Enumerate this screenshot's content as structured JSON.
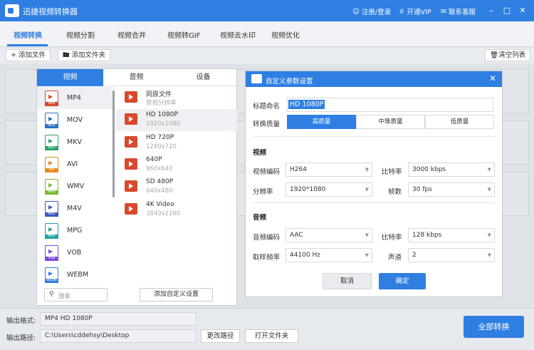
{
  "app": {
    "title": "迅捷视频转换器"
  },
  "header": {
    "login": "注册/登录",
    "vip": "开通VIP",
    "support": "联系客服"
  },
  "tabs": [
    "视频转换",
    "视频分割",
    "视频合并",
    "视频转GIF",
    "视频去水印",
    "视频优化"
  ],
  "toolbar": {
    "add_file": "添加文件",
    "add_folder": "添加文件夹",
    "clear_list": "清空列表"
  },
  "format_panel": {
    "tabs": [
      "视频",
      "音频",
      "设备"
    ],
    "formats": [
      "MP4",
      "MOV",
      "MKV",
      "AVI",
      "WMV",
      "M4V",
      "MPG",
      "VOB",
      "WEBM"
    ],
    "resolutions": [
      {
        "name": "同原文件",
        "sub": "原视分辨率"
      },
      {
        "name": "HD 1080P",
        "sub": "1920x1080"
      },
      {
        "name": "HD 720P",
        "sub": "1280x720"
      },
      {
        "name": "640P",
        "sub": "960x640"
      },
      {
        "name": "SD 480P",
        "sub": "640x480"
      },
      {
        "name": "4K Video",
        "sub": "3840x2160"
      }
    ],
    "search_placeholder": "搜索",
    "add_custom": "添加自定义设置"
  },
  "dialog": {
    "title": "自定义参数设置",
    "name_label": "标题命名",
    "name_value": "HD 1080P",
    "quality_label": "转换质量",
    "quality_options": [
      "高质量",
      "中等质量",
      "低质量"
    ],
    "video_section": "视频",
    "video_codec_label": "视频编码",
    "video_codec": "H264",
    "video_bitrate_label": "比特率",
    "video_bitrate": "3000 kbps",
    "resolution_label": "分辨率",
    "resolution": "1920*1080",
    "fps_label": "帧数",
    "fps": "30 fps",
    "audio_section": "音频",
    "audio_codec_label": "音频编码",
    "audio_codec": "AAC",
    "audio_bitrate_label": "比特率",
    "audio_bitrate": "128 kbps",
    "sample_label": "取样频率",
    "sample_rate": "44100 Hz",
    "channel_label": "声道",
    "channel": "2",
    "cancel": "取消",
    "ok": "确定"
  },
  "bottom": {
    "format_label": "输出格式:",
    "format_value": "MP4  HD 1080P",
    "path_label": "输出路径:",
    "path_value": "C:\\Users\\cddehsy\\Desktop",
    "change_path": "更改路径",
    "open_folder": "打开文件夹",
    "convert_all": "全部转换"
  }
}
